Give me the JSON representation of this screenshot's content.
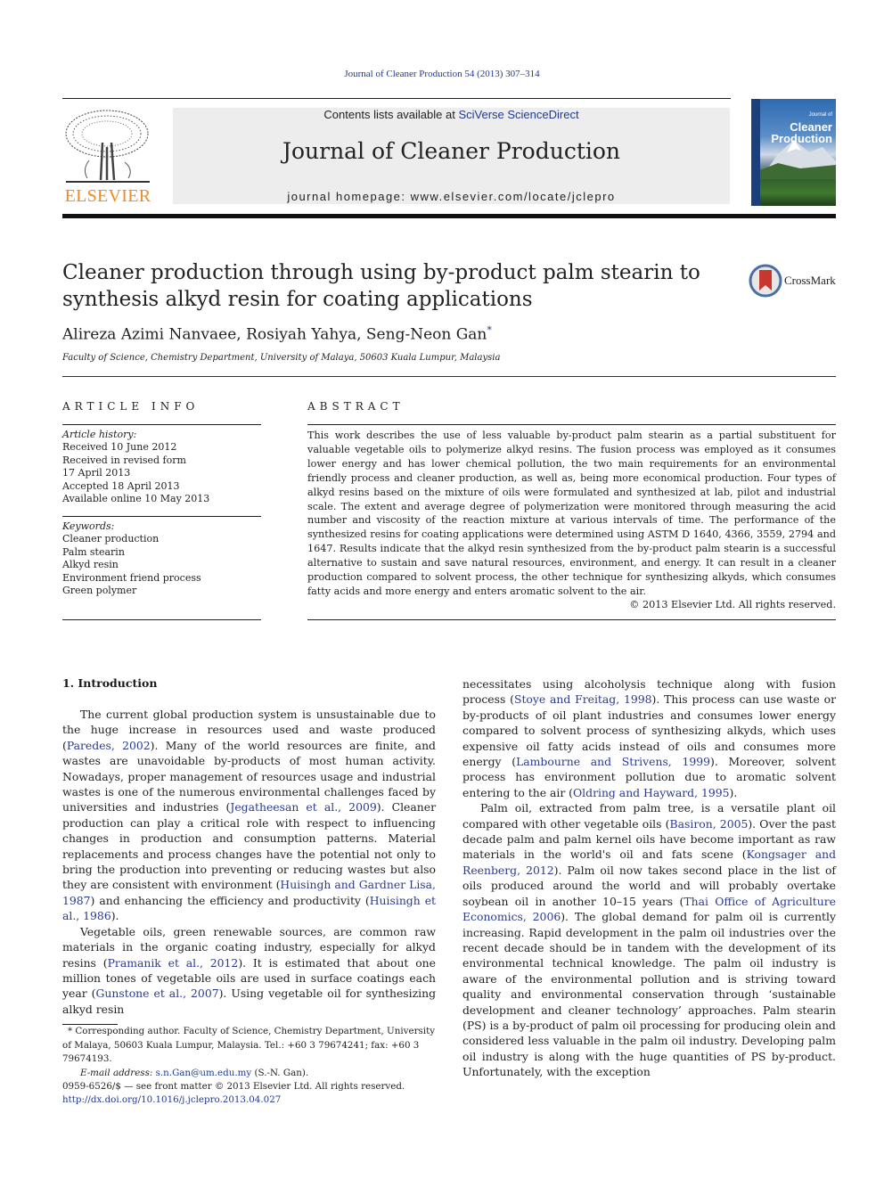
{
  "header": {
    "journal_reference": "Journal of Cleaner Production 54 (2013) 307–314",
    "publisher_logo_text": "ELSEVIER",
    "contents_prefix": "Contents lists available at ",
    "contents_link": "SciVerse ScienceDirect",
    "journal_name": "Journal of Cleaner Production",
    "homepage_prefix": "journal homepage: ",
    "homepage_url": "www.elsevier.com/locate/jclepro",
    "cover": {
      "title_line1": "Cleaner",
      "title_line2": "Production",
      "small_caption": "Journal of"
    }
  },
  "article": {
    "title": "Cleaner production through using by-product palm stearin to synthesis alkyd resin for coating applications",
    "crossmark_label": "CrossMark",
    "authors": "Alireza Azimi Nanvaee, Rosiyah Yahya, Seng-Neon Gan",
    "corresponding_marker": "*",
    "affiliation": "Faculty of Science, Chemistry Department, University of Malaya, 50603 Kuala Lumpur, Malaysia"
  },
  "article_info": {
    "heading": "ARTICLE INFO",
    "history_label": "Article history:",
    "history": [
      "Received 10 June 2012",
      "Received in revised form",
      "17 April 2013",
      "Accepted 18 April 2013",
      "Available online 10 May 2013"
    ],
    "keywords_label": "Keywords:",
    "keywords": [
      "Cleaner production",
      "Palm stearin",
      "Alkyd resin",
      "Environment friend process",
      "Green polymer"
    ]
  },
  "abstract": {
    "heading": "ABSTRACT",
    "text": "This work describes the use of less valuable by-product palm stearin as a partial substituent for valuable vegetable oils to polymerize alkyd resins. The fusion process was employed as it consumes lower energy and has lower chemical pollution, the two main requirements for an environmental friendly process and cleaner production, as well as, being more economical production. Four types of alkyd resins based on the mixture of oils were formulated and synthesized at lab, pilot and industrial scale. The extent and average degree of polymerization were monitored through measuring the acid number and viscosity of the reaction mixture at various intervals of time. The performance of the synthesized resins for coating applications were determined using ASTM D 1640, 4366, 3559, 2794 and 1647. Results indicate that the alkyd resin synthesized from the by-product palm stearin is a successful alternative to sustain and save natural resources, environment, and energy. It can result in a cleaner production compared to solvent process, the other technique for synthesizing alkyds, which consumes fatty acids and more energy and enters aromatic solvent to the air.",
    "copyright": "© 2013 Elsevier Ltd. All rights reserved."
  },
  "introduction": {
    "heading": "1.  Introduction",
    "left_paragraphs": [
      [
        {
          "t": "The current global production system is unsustainable due to the huge increase in resources used and waste produced ("
        },
        {
          "c": "Paredes, 2002"
        },
        {
          "t": "). Many of the world resources are finite, and wastes are unavoidable by-products of most human activity. Nowadays, proper management of resources usage and industrial wastes is one of the numerous environmental challenges faced by universities and industries ("
        },
        {
          "c": "Jegatheesan et al., 2009"
        },
        {
          "t": "). Cleaner production can play a critical role with respect to influencing changes in production and consumption patterns. Material replacements and process changes have the potential not only to bring the production into preventing or reducing wastes but also they are consistent with environment ("
        },
        {
          "c": "Huisingh and Gardner Lisa, 1987"
        },
        {
          "t": ") and enhancing the efficiency and productivity ("
        },
        {
          "c": "Huisingh et al., 1986"
        },
        {
          "t": ")."
        }
      ],
      [
        {
          "t": "Vegetable oils, green renewable sources, are common raw materials in the organic coating industry, especially for alkyd resins ("
        },
        {
          "c": "Pramanik et al., 2012"
        },
        {
          "t": "). It is estimated that about one million tones of vegetable oils are used in surface coatings each year ("
        },
        {
          "c": "Gunstone et al., 2007"
        },
        {
          "t": "). Using vegetable oil for synthesizing alkyd resin"
        }
      ]
    ],
    "right_paragraphs": [
      [
        {
          "t": "necessitates using alcoholysis technique along with fusion process ("
        },
        {
          "c": "Stoye and Freitag, 1998"
        },
        {
          "t": "). This process can use waste or by-products of oil plant industries and consumes lower energy compared to solvent process of synthesizing alkyds, which uses expensive oil fatty acids instead of oils and consumes more energy ("
        },
        {
          "c": "Lambourne and Strivens, 1999"
        },
        {
          "t": "). Moreover, solvent process has environment pollution due to aromatic solvent entering to the air ("
        },
        {
          "c": "Oldring and Hayward, 1995"
        },
        {
          "t": ")."
        }
      ],
      [
        {
          "t": "Palm oil, extracted from palm tree, is a versatile plant oil compared with other vegetable oils ("
        },
        {
          "c": "Basiron, 2005"
        },
        {
          "t": "). Over the past decade palm and palm kernel oils have become important as raw materials in the world's oil and fats scene ("
        },
        {
          "c": "Kongsager and Reenberg, 2012"
        },
        {
          "t": "). Palm oil now takes second place in the list of oils produced around the world and will probably overtake soybean oil in another 10–15 years ("
        },
        {
          "c": "Thai Office of Agriculture Economics, 2006"
        },
        {
          "t": "). The global demand for palm oil is currently increasing. Rapid development in the palm oil industries over the recent decade should be in tandem with the development of its environmental technical knowledge. The palm oil industry is aware of the environmental pollution and is striving toward quality and environmental conservation through ‘sustainable development and cleaner technology’ approaches. Palm stearin (PS) is a by-product of palm oil processing for producing olein and considered less valuable in the palm oil industry. Developing palm oil industry is along with the huge quantities of PS by-product. Unfortunately, with the exception"
        }
      ]
    ]
  },
  "footnote": {
    "marker": "*",
    "text": " Corresponding author. Faculty of Science, Chemistry Department, University of Malaya, 50603 Kuala Lumpur, Malaysia. Tel.: +60 3 79674241; fax: +60 3 79674193.",
    "email_label": "E-mail address: ",
    "email": "s.n.Gan@um.edu.my",
    "email_suffix": " (S.-N. Gan)."
  },
  "front_matter": {
    "issn_line": "0959-6526/$ — see front matter © 2013 Elsevier Ltd. All rights reserved.",
    "doi_url": "http://dx.doi.org/10.1016/j.jclepro.2013.04.027"
  },
  "colors": {
    "link": "#1f3a93",
    "elsevier_orange": "#f08a24",
    "banner_bg": "#ededed"
  }
}
